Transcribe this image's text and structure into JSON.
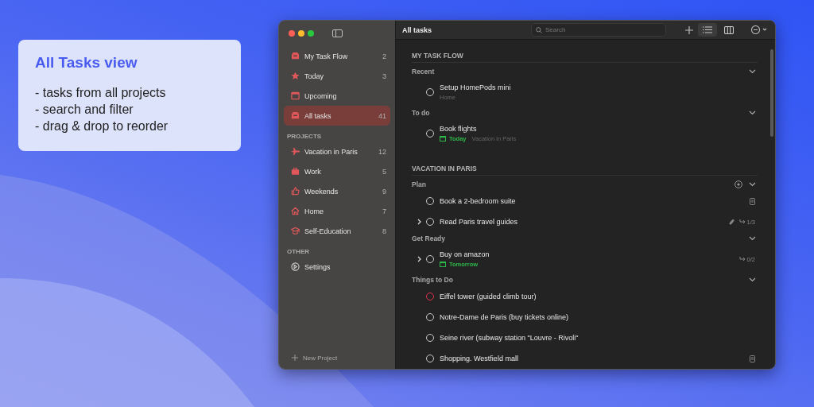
{
  "promo": {
    "title": "All Tasks view",
    "bullets": [
      "- tasks from all projects",
      "- search and filter",
      "- drag & drop to reorder"
    ]
  },
  "sidebar": {
    "sections": [
      {
        "items": [
          {
            "kind": "inbox",
            "label": "My Task Flow",
            "count": "2",
            "selected": false
          },
          {
            "kind": "star",
            "label": "Today",
            "count": "3",
            "selected": false
          },
          {
            "kind": "calendar",
            "label": "Upcoming",
            "selected": false
          },
          {
            "kind": "inbox",
            "label": "All tasks",
            "count": "41",
            "selected": true
          }
        ]
      },
      {
        "title": "PROJECTS",
        "items": [
          {
            "kind": "plane",
            "label": "Vacation in Paris",
            "count": "12",
            "selected": false
          },
          {
            "kind": "briefcase",
            "label": "Work",
            "count": "5",
            "selected": false
          },
          {
            "kind": "thumb",
            "label": "Weekends",
            "count": "9",
            "selected": false
          },
          {
            "kind": "house",
            "label": "Home",
            "count": "7",
            "selected": false
          },
          {
            "kind": "cap",
            "label": "Self-Education",
            "count": "8",
            "selected": false
          }
        ]
      },
      {
        "title": "OTHER",
        "items": [
          {
            "kind": "gear",
            "label": "Settings",
            "selected": false
          }
        ]
      }
    ],
    "new_project": "New Project"
  },
  "toolbar": {
    "title": "All tasks",
    "search": {
      "placeholder": "Search"
    },
    "view": [
      {
        "kind": "list",
        "selected": true
      },
      {
        "kind": "board",
        "selected": false
      }
    ]
  },
  "sections": [
    {
      "title": "MY TASK FLOW",
      "groups": [
        {
          "title": "Recent",
          "expanded": true,
          "focus": false,
          "tasks": [
            {
              "title": "Setup HomePods mini",
              "project": "Home",
              "expandable": false,
              "flagged": false,
              "note": false,
              "attachment": false
            }
          ]
        },
        {
          "title": "To do",
          "expanded": true,
          "focus": false,
          "tasks": [
            {
              "title": "Book flights",
              "date": "Today",
              "project": "Vacation in Paris",
              "expandable": false,
              "flagged": false,
              "note": false,
              "attachment": false
            }
          ]
        }
      ]
    },
    {
      "title": "VACATION IN PARIS",
      "groups": [
        {
          "title": "Plan",
          "expanded": true,
          "focus": true,
          "tasks": [
            {
              "title": "Book a 2-bedroom suite",
              "expandable": false,
              "flagged": false,
              "note": true,
              "attachment": false
            },
            {
              "title": "Read Paris travel guides",
              "expandable": true,
              "flagged": false,
              "note": false,
              "attachment": true,
              "subtasks": "1/3"
            }
          ]
        },
        {
          "title": "Get Ready",
          "expanded": true,
          "focus": false,
          "tasks": [
            {
              "title": "Buy on amazon",
              "date": "Tomorrow",
              "expandable": true,
              "flagged": false,
              "note": false,
              "attachment": false,
              "subtasks": "0/2"
            }
          ]
        },
        {
          "title": "Things to Do",
          "expanded": true,
          "focus": false,
          "tasks": [
            {
              "title": "Eiffel tower (guided climb tour)",
              "expandable": false,
              "flagged": true,
              "note": false,
              "attachment": false
            },
            {
              "title": "Notre-Dame de Paris (buy tickets online)",
              "expandable": false,
              "flagged": false,
              "note": false,
              "attachment": false
            },
            {
              "title": "Seine river (subway station \"Louvre - Rivoli\"",
              "expandable": false,
              "flagged": false,
              "note": false,
              "attachment": false
            },
            {
              "title": "Shopping. Westfield mall",
              "expandable": false,
              "flagged": false,
              "note": true,
              "attachment": false
            }
          ]
        }
      ]
    }
  ]
}
